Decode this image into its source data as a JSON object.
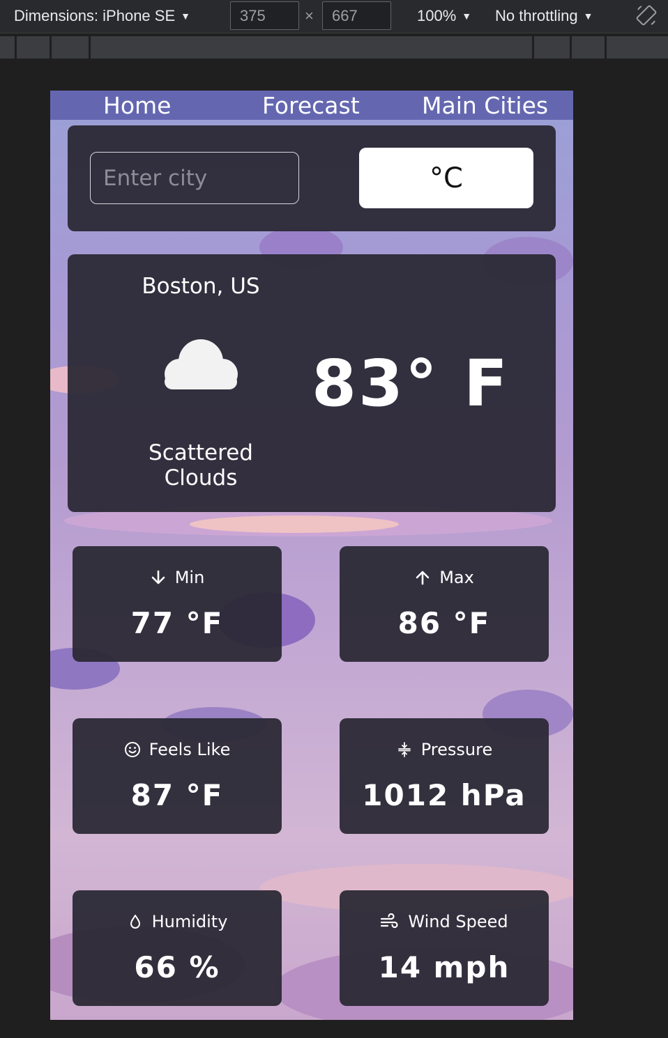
{
  "devtools": {
    "dimensions_label": "Dimensions: iPhone SE",
    "width_value": "375",
    "height_value": "667",
    "times_symbol": "×",
    "zoom_label": "100%",
    "throttling_label": "No throttling",
    "caret": "▼"
  },
  "nav": {
    "home": "Home",
    "forecast": "Forecast",
    "main_cities": "Main Cities"
  },
  "search": {
    "placeholder": "Enter city",
    "unit_toggle": "°C"
  },
  "current": {
    "city": "Boston, US",
    "icon": "cloud-icon",
    "temperature": "83° F",
    "condition_line1": "Scattered",
    "condition_line2": "Clouds"
  },
  "stats": {
    "min": {
      "label": "Min",
      "value": "77 °F",
      "icon": "arrow-down-icon"
    },
    "max": {
      "label": "Max",
      "value": "86 °F",
      "icon": "arrow-up-icon"
    },
    "feels_like": {
      "label": "Feels Like",
      "value": "87 °F",
      "icon": "smiley-icon"
    },
    "pressure": {
      "label": "Pressure",
      "value": "1012 hPa",
      "icon": "compress-icon"
    },
    "humidity": {
      "label": "Humidity",
      "value": "66 %",
      "icon": "droplet-icon"
    },
    "wind_speed": {
      "label": "Wind Speed",
      "value": "14 mph",
      "icon": "wind-icon"
    }
  },
  "colors": {
    "devtools_bg": "#292a2d",
    "nav_bg": "#6467b0",
    "panel_bg": "#2a2834",
    "unit_button_bg": "#ffffff"
  }
}
